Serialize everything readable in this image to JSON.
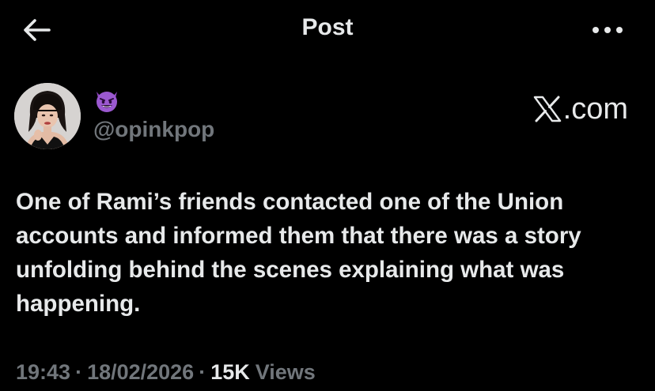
{
  "topbar": {
    "title": "Post",
    "back_icon": "arrow-left-icon",
    "more_icon": "more-horizontal-icon"
  },
  "author": {
    "display_name_emoji": "smiling-imp-emoji",
    "handle": "@opinkpop",
    "avatar": "profile-photo"
  },
  "watermark": {
    "text": ".com",
    "logo": "x-logo-icon"
  },
  "tweet": {
    "text": "One of Rami’s friends contacted one of the Union accounts and informed them that there was a story unfolding behind the scenes explaining what was happening."
  },
  "meta": {
    "time": "19:43",
    "separator": "·",
    "date": "18/02/2026",
    "views_count": "15K",
    "views_label": "Views"
  },
  "colors": {
    "background": "#000000",
    "primary_text": "#e7e9ea",
    "secondary_text": "#71767b",
    "emoji_purple": "#9b59d0"
  }
}
